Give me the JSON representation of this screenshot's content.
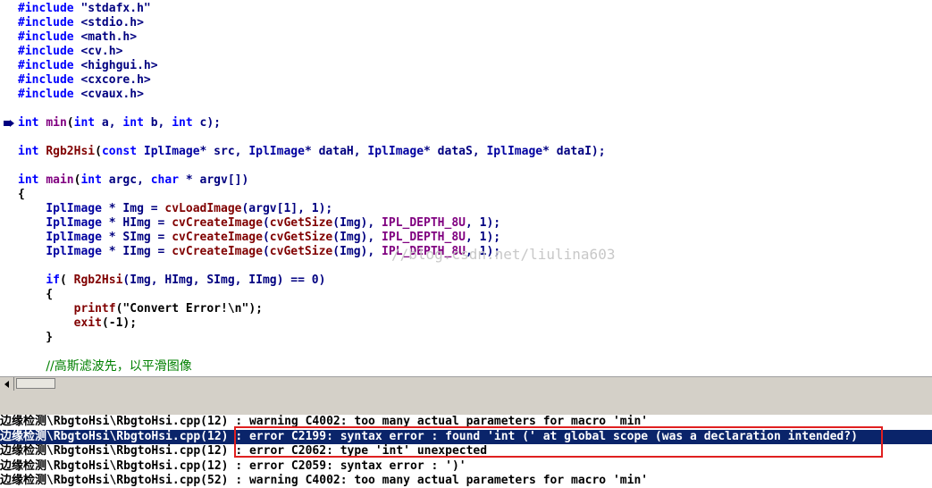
{
  "editor": {
    "lines": {
      "l1": {
        "a": "#include",
        "b": " \"stdafx.h\""
      },
      "l2": {
        "a": "#include",
        "b": " <stdio.h>"
      },
      "l3": {
        "a": "#include",
        "b": " <math.h>"
      },
      "l4": {
        "a": "#include",
        "b": " <cv.h>"
      },
      "l5": {
        "a": "#include",
        "b": " <highgui.h>"
      },
      "l6": {
        "a": "#include",
        "b": " <cxcore.h>"
      },
      "l7": {
        "a": "#include",
        "b": " <cvaux.h>"
      },
      "l8": {
        "a": "int",
        "b": " ",
        "c": "min",
        "d": "(",
        "e": "int",
        "f": " a, ",
        "g": "int",
        "h": " b, ",
        "i": "int",
        "j": " c);"
      },
      "l9": {
        "a": "int",
        "b": " ",
        "c": "Rgb2Hsi",
        "d": "(",
        "e": "const",
        "f": " ",
        "g": "IplImage",
        "h": "* src, ",
        "i": "IplImage",
        "j": "* dataH, ",
        "k": "IplImage",
        "l": "* dataS, ",
        "m": "IplImage",
        "n": "* dataI);"
      },
      "l10": {
        "a": "int",
        "b": " ",
        "c": "main",
        "d": "(",
        "e": "int",
        "f": " argc, ",
        "g": "char",
        "h": " * argv[])"
      },
      "l11": {
        "a": "{"
      },
      "l12": {
        "a": "    ",
        "b": "IplImage",
        "c": " * Img = ",
        "d": "cvLoadImage",
        "e": "(argv[1], 1);"
      },
      "l13": {
        "a": "    ",
        "b": "IplImage",
        "c": " * HImg = ",
        "d": "cvCreateImage",
        "e": "(",
        "f": "cvGetSize",
        "g": "(Img), ",
        "h": "IPL_DEPTH_8U",
        "i": ", 1);"
      },
      "l14": {
        "a": "    ",
        "b": "IplImage",
        "c": " * SImg = ",
        "d": "cvCreateImage",
        "e": "(",
        "f": "cvGetSize",
        "g": "(Img), ",
        "h": "IPL_DEPTH_8U",
        "i": ", 1);"
      },
      "l15": {
        "a": "    ",
        "b": "IplImage",
        "c": " * IImg = ",
        "d": "cvCreateImage",
        "e": "(",
        "f": "cvGetSize",
        "g": "(Img), ",
        "h": "IPL_DEPTH_8U",
        "i": ", 1);"
      },
      "l16": {
        "a": "    ",
        "b": "if",
        "c": "( ",
        "d": "Rgb2Hsi",
        "e": "(Img, HImg, SImg, IImg) == 0)"
      },
      "l17": {
        "a": "    {"
      },
      "l18": {
        "a": "        ",
        "b": "printf",
        "c": "(",
        "d": "\"Convert Error!\\n\"",
        "e": ");"
      },
      "l19": {
        "a": "        ",
        "b": "exit",
        "c": "(-1);"
      },
      "l20": {
        "a": "    }"
      },
      "l21": {
        "a": "    ",
        "b": "//高斯滤波先，以平滑图像"
      }
    },
    "watermark": "//blog.csdn.net/liulina603"
  },
  "output": {
    "lines": [
      "边缘检测\\RbgtoHsi\\RbgtoHsi.cpp(12) : warning C4002: too many actual parameters for macro 'min'",
      "边缘检测\\RbgtoHsi\\RbgtoHsi.cpp(12) : error C2199: syntax error : found 'int (' at global scope (was a declaration intended?)",
      "边缘检测\\RbgtoHsi\\RbgtoHsi.cpp(12) : error C2062: type 'int' unexpected",
      "边缘检测\\RbgtoHsi\\RbgtoHsi.cpp(12) : error C2059: syntax error : ')'",
      "边缘检测\\RbgtoHsi\\RbgtoHsi.cpp(52) : warning C4002: too many actual parameters for macro 'min'"
    ],
    "selected_index": 1
  },
  "colors": {
    "selection": "#0a246a",
    "highlight_box": "#e02020",
    "keyword": "#0000ff",
    "function": "#800000",
    "macro": "#800080",
    "comment": "#008000"
  },
  "icons": {
    "breakpoint": "current-line-arrow-icon",
    "scroll_left": "scroll-left-arrow-icon"
  }
}
